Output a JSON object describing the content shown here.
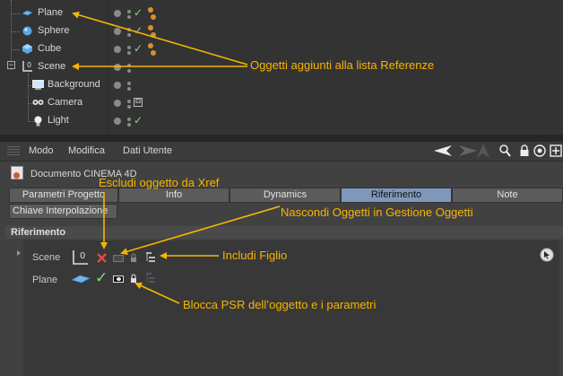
{
  "object_manager": {
    "objects": [
      {
        "name": "Plane",
        "icon": "plane-icon"
      },
      {
        "name": "Sphere",
        "icon": "sphere-icon"
      },
      {
        "name": "Cube",
        "icon": "cube-icon"
      },
      {
        "name": "Scene",
        "icon": "null-object-icon"
      },
      {
        "name": "Background",
        "icon": "background-icon"
      },
      {
        "name": "Camera",
        "icon": "camera-icon"
      },
      {
        "name": "Light",
        "icon": "light-icon"
      }
    ]
  },
  "attributes": {
    "menu": [
      "Modo",
      "Modifica",
      "Dati Utente"
    ],
    "document_title": "Documento CINEMA 4D",
    "tabs": [
      {
        "label": "Parametri Progetto",
        "active": false
      },
      {
        "label": "Info",
        "active": false
      },
      {
        "label": "Dynamics",
        "active": false
      },
      {
        "label": "Riferimento",
        "active": true
      },
      {
        "label": "Note",
        "active": false
      }
    ],
    "tab_row2": "Chiave Interpolazione",
    "section_title": "Riferimento",
    "rows": [
      {
        "label": "Scene"
      },
      {
        "label": "Plane"
      }
    ]
  },
  "annotations": {
    "objects_added": "Oggetti aggiunti alla lista Referenze",
    "exclude_xref": "Escludi oggetto da Xref",
    "hide_objects": "Nascondi Oggetti in Gestione Oggetti",
    "include_child": "Includi Figlio",
    "lock_psr": "Blocca PSR dell’oggetto e i parametri"
  },
  "colors": {
    "annotation": "#f7b500",
    "active_tab": "#7f98ba",
    "check_green": "#7ce07a",
    "exclude_red": "#e24a4a"
  }
}
